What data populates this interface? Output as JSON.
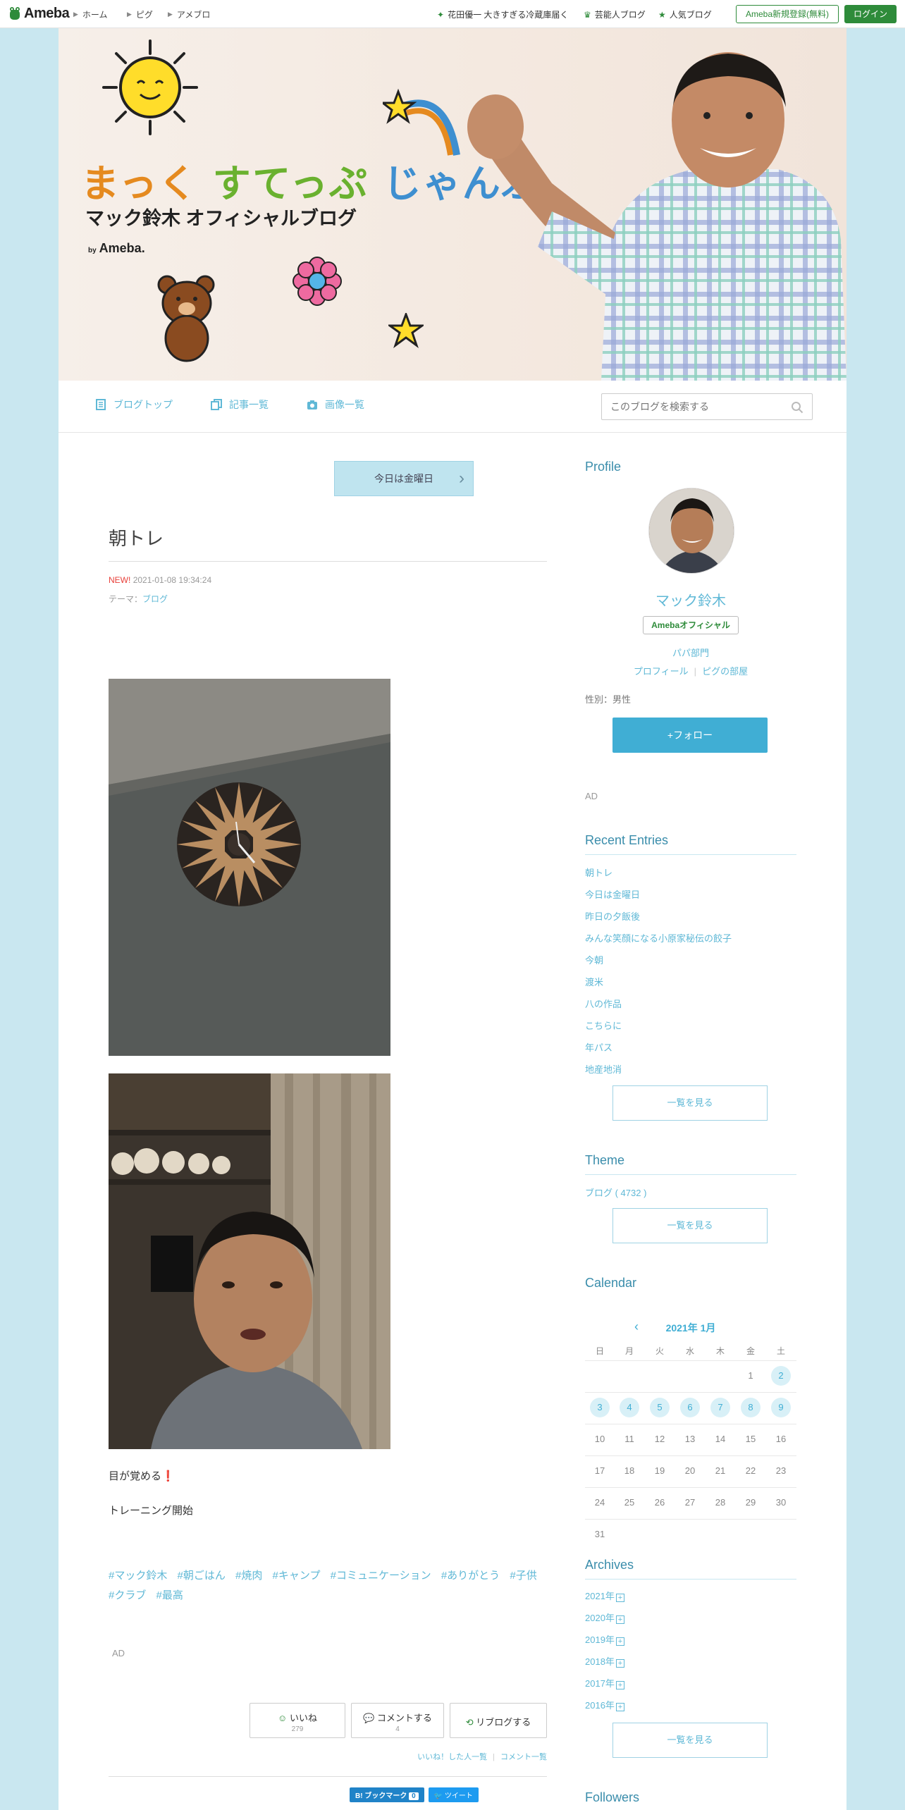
{
  "topbar": {
    "logo": "Ameba",
    "nav": [
      "ホーム",
      "ピグ",
      "アメブロ"
    ],
    "links": [
      "花田優一 大きすぎる冷蔵庫届く",
      "芸能人ブログ",
      "人気ブログ"
    ],
    "register": "Ameba新規登録(無料)",
    "login": "ログイン"
  },
  "banner": {
    "title_a": "まっく",
    "title_b": "すてっぷ",
    "title_c": "じゃんぷ",
    "subtitle": "マック鈴木 オフィシャルブログ",
    "by": "by",
    "by_brand": "Ameba."
  },
  "subnav": {
    "items": [
      "ブログトップ",
      "記事一覧",
      "画像一覧"
    ],
    "search_placeholder": "このブログを検索する"
  },
  "post": {
    "today_btn": "今日は金曜日",
    "title": "朝トレ",
    "new_label": "NEW!",
    "datetime": "2021-01-08 19:34:24",
    "theme_label": "テーマ：",
    "theme_value": "ブログ",
    "body_line1": "目が覚める",
    "body_ex": "❗",
    "body_line2": "トレーニング開始",
    "hashtags": [
      "#マック鈴木",
      "#朝ごはん",
      "#焼肉",
      "#キャンプ",
      "#コミュニケーション",
      "#ありがとう",
      "#子供",
      "#クラブ",
      "#最高"
    ],
    "ad": "AD",
    "like_label": "いいね",
    "like_count": "279",
    "comment_label": "コメントする",
    "comment_count": "4",
    "reblog_label": "リブログする",
    "liked_list": "いいね！した人一覧",
    "comment_list": "コメント一覧",
    "hatena": "B! ブックマーク",
    "hatena_count": "0",
    "tweet": "ツイート"
  },
  "sidebar": {
    "profile_heading": "Profile",
    "name": "マック鈴木",
    "badge": "Amebaオフィシャル",
    "category": "パパ部門",
    "link_profile": "プロフィール",
    "link_pig": "ピグの部屋",
    "gender": "性別：男性",
    "follow": "+フォロー",
    "ad": "AD",
    "recent_heading": "Recent Entries",
    "recent": [
      "朝トレ",
      "今日は金曜日",
      "昨日の夕飯後",
      "みんな笑顔になる小原家秘伝の餃子",
      "今朝",
      "渡米",
      "八の作品",
      "こちらに",
      "年パス",
      "地産地消"
    ],
    "recent_more": "一覧を見る",
    "theme_heading": "Theme",
    "theme_item": "ブログ ( 4732 )",
    "theme_more": "一覧を見る",
    "calendar_heading": "Calendar",
    "calendar_month": "2021年 1月",
    "weekdays": [
      "日",
      "月",
      "火",
      "水",
      "木",
      "金",
      "土"
    ],
    "archives_heading": "Archives",
    "archives": [
      "2021年",
      "2020年",
      "2019年",
      "2018年",
      "2017年",
      "2016年"
    ],
    "archives_more": "一覧を見る",
    "followers_heading": "Followers"
  },
  "calendar_days": {
    "d1": "1",
    "d2": "2",
    "d3": "3",
    "d4": "4",
    "d5": "5",
    "d6": "6",
    "d7": "7",
    "d8": "8",
    "d9": "9",
    "d10": "10",
    "d11": "11",
    "d12": "12",
    "d13": "13",
    "d14": "14",
    "d15": "15",
    "d16": "16",
    "d17": "17",
    "d18": "18",
    "d19": "19",
    "d20": "20",
    "d21": "21",
    "d22": "22",
    "d23": "23",
    "d24": "24",
    "d25": "25",
    "d26": "26",
    "d27": "27",
    "d28": "28",
    "d29": "29",
    "d30": "30",
    "d31": "31"
  },
  "colors": {
    "accent": "#40aed4",
    "brand_green": "#2e8b3a",
    "page_bg": "#c9e7f0"
  }
}
